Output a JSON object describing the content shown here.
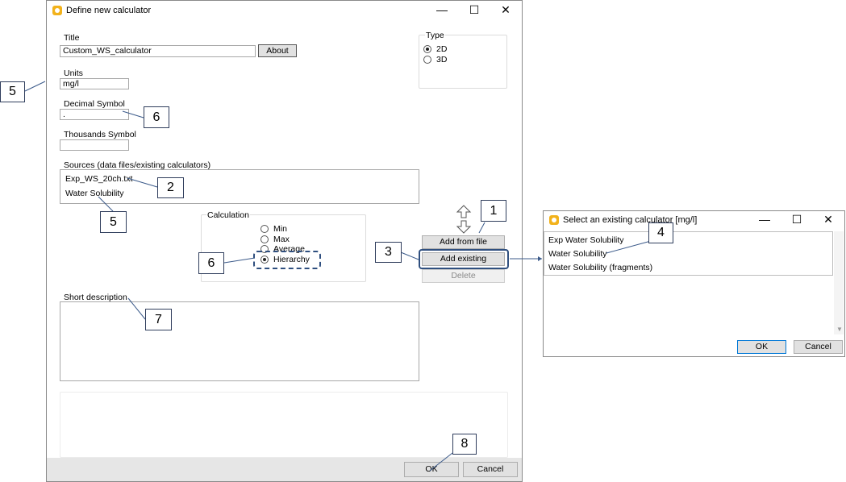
{
  "main_window": {
    "title": "Define new calculator",
    "controls": {
      "minimize": "—",
      "maximize": "☐",
      "close": "✕"
    },
    "title_field": {
      "label": "Title",
      "value": "Custom_WS_calculator"
    },
    "about_button": "About",
    "type_group": {
      "label": "Type",
      "options": [
        "2D",
        "3D"
      ],
      "selected": "2D"
    },
    "units_field": {
      "label": "Units",
      "value": "mg/l"
    },
    "decimal_field": {
      "label": "Decimal Symbol",
      "value": "."
    },
    "thousands_field": {
      "label": "Thousands Symbol",
      "value": ""
    },
    "sources": {
      "label": "Sources (data files/existing calculators)",
      "items": [
        "Exp_WS_20ch.txt",
        "Water Solubility"
      ]
    },
    "calculation": {
      "label": "Calculation",
      "options": [
        "Min",
        "Max",
        "Average",
        "Hierarchy"
      ],
      "selected": "Hierarchy"
    },
    "buttons": {
      "add_from_file": "Add from file",
      "add_existing": "Add existing",
      "delete": "Delete"
    },
    "short_description": {
      "label": "Short description",
      "value": ""
    },
    "footer": {
      "ok": "OK",
      "cancel": "Cancel"
    }
  },
  "sub_window": {
    "title": "Select an existing calculator [mg/l]",
    "controls": {
      "minimize": "—",
      "maximize": "☐",
      "close": "✕"
    },
    "items": [
      "Exp Water Solubility",
      "Water Solubility",
      "Water Solubility (fragments)"
    ],
    "buttons": {
      "ok": "OK",
      "cancel": "Cancel"
    }
  },
  "callouts": {
    "c5a": "5",
    "c6a": "6",
    "c2": "2",
    "c5b": "5",
    "c1": "1",
    "c3": "3",
    "c6b": "6",
    "c7": "7",
    "c8": "8",
    "c4": "4"
  },
  "colors": {
    "accent": "#2f4f7f",
    "app_icon": "#f2b21b",
    "footer_bar": "#e6e6e6"
  }
}
